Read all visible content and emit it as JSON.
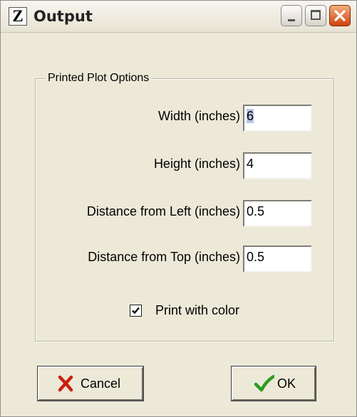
{
  "window": {
    "title": "Output",
    "app_icon_letter": "Z"
  },
  "group": {
    "title": "Printed Plot Options",
    "fields": [
      {
        "label": "Width (inches)",
        "value": "6"
      },
      {
        "label": "Height (inches)",
        "value": "4"
      },
      {
        "label": "Distance from Left (inches)",
        "value": "0.5"
      },
      {
        "label": "Distance from Top (inches)",
        "value": "0.5"
      }
    ],
    "print_color": {
      "label": "Print with color",
      "checked": true
    }
  },
  "buttons": {
    "cancel_label": "Cancel",
    "ok_label": "OK"
  },
  "colors": {
    "dialog_background": "#ece9d8",
    "close_button": "#d2400f",
    "cancel_icon": "#cc1f0f",
    "ok_icon": "#2c9a1c"
  },
  "icons": {
    "cancel": "x-mark-icon",
    "ok": "checkmark-icon"
  }
}
